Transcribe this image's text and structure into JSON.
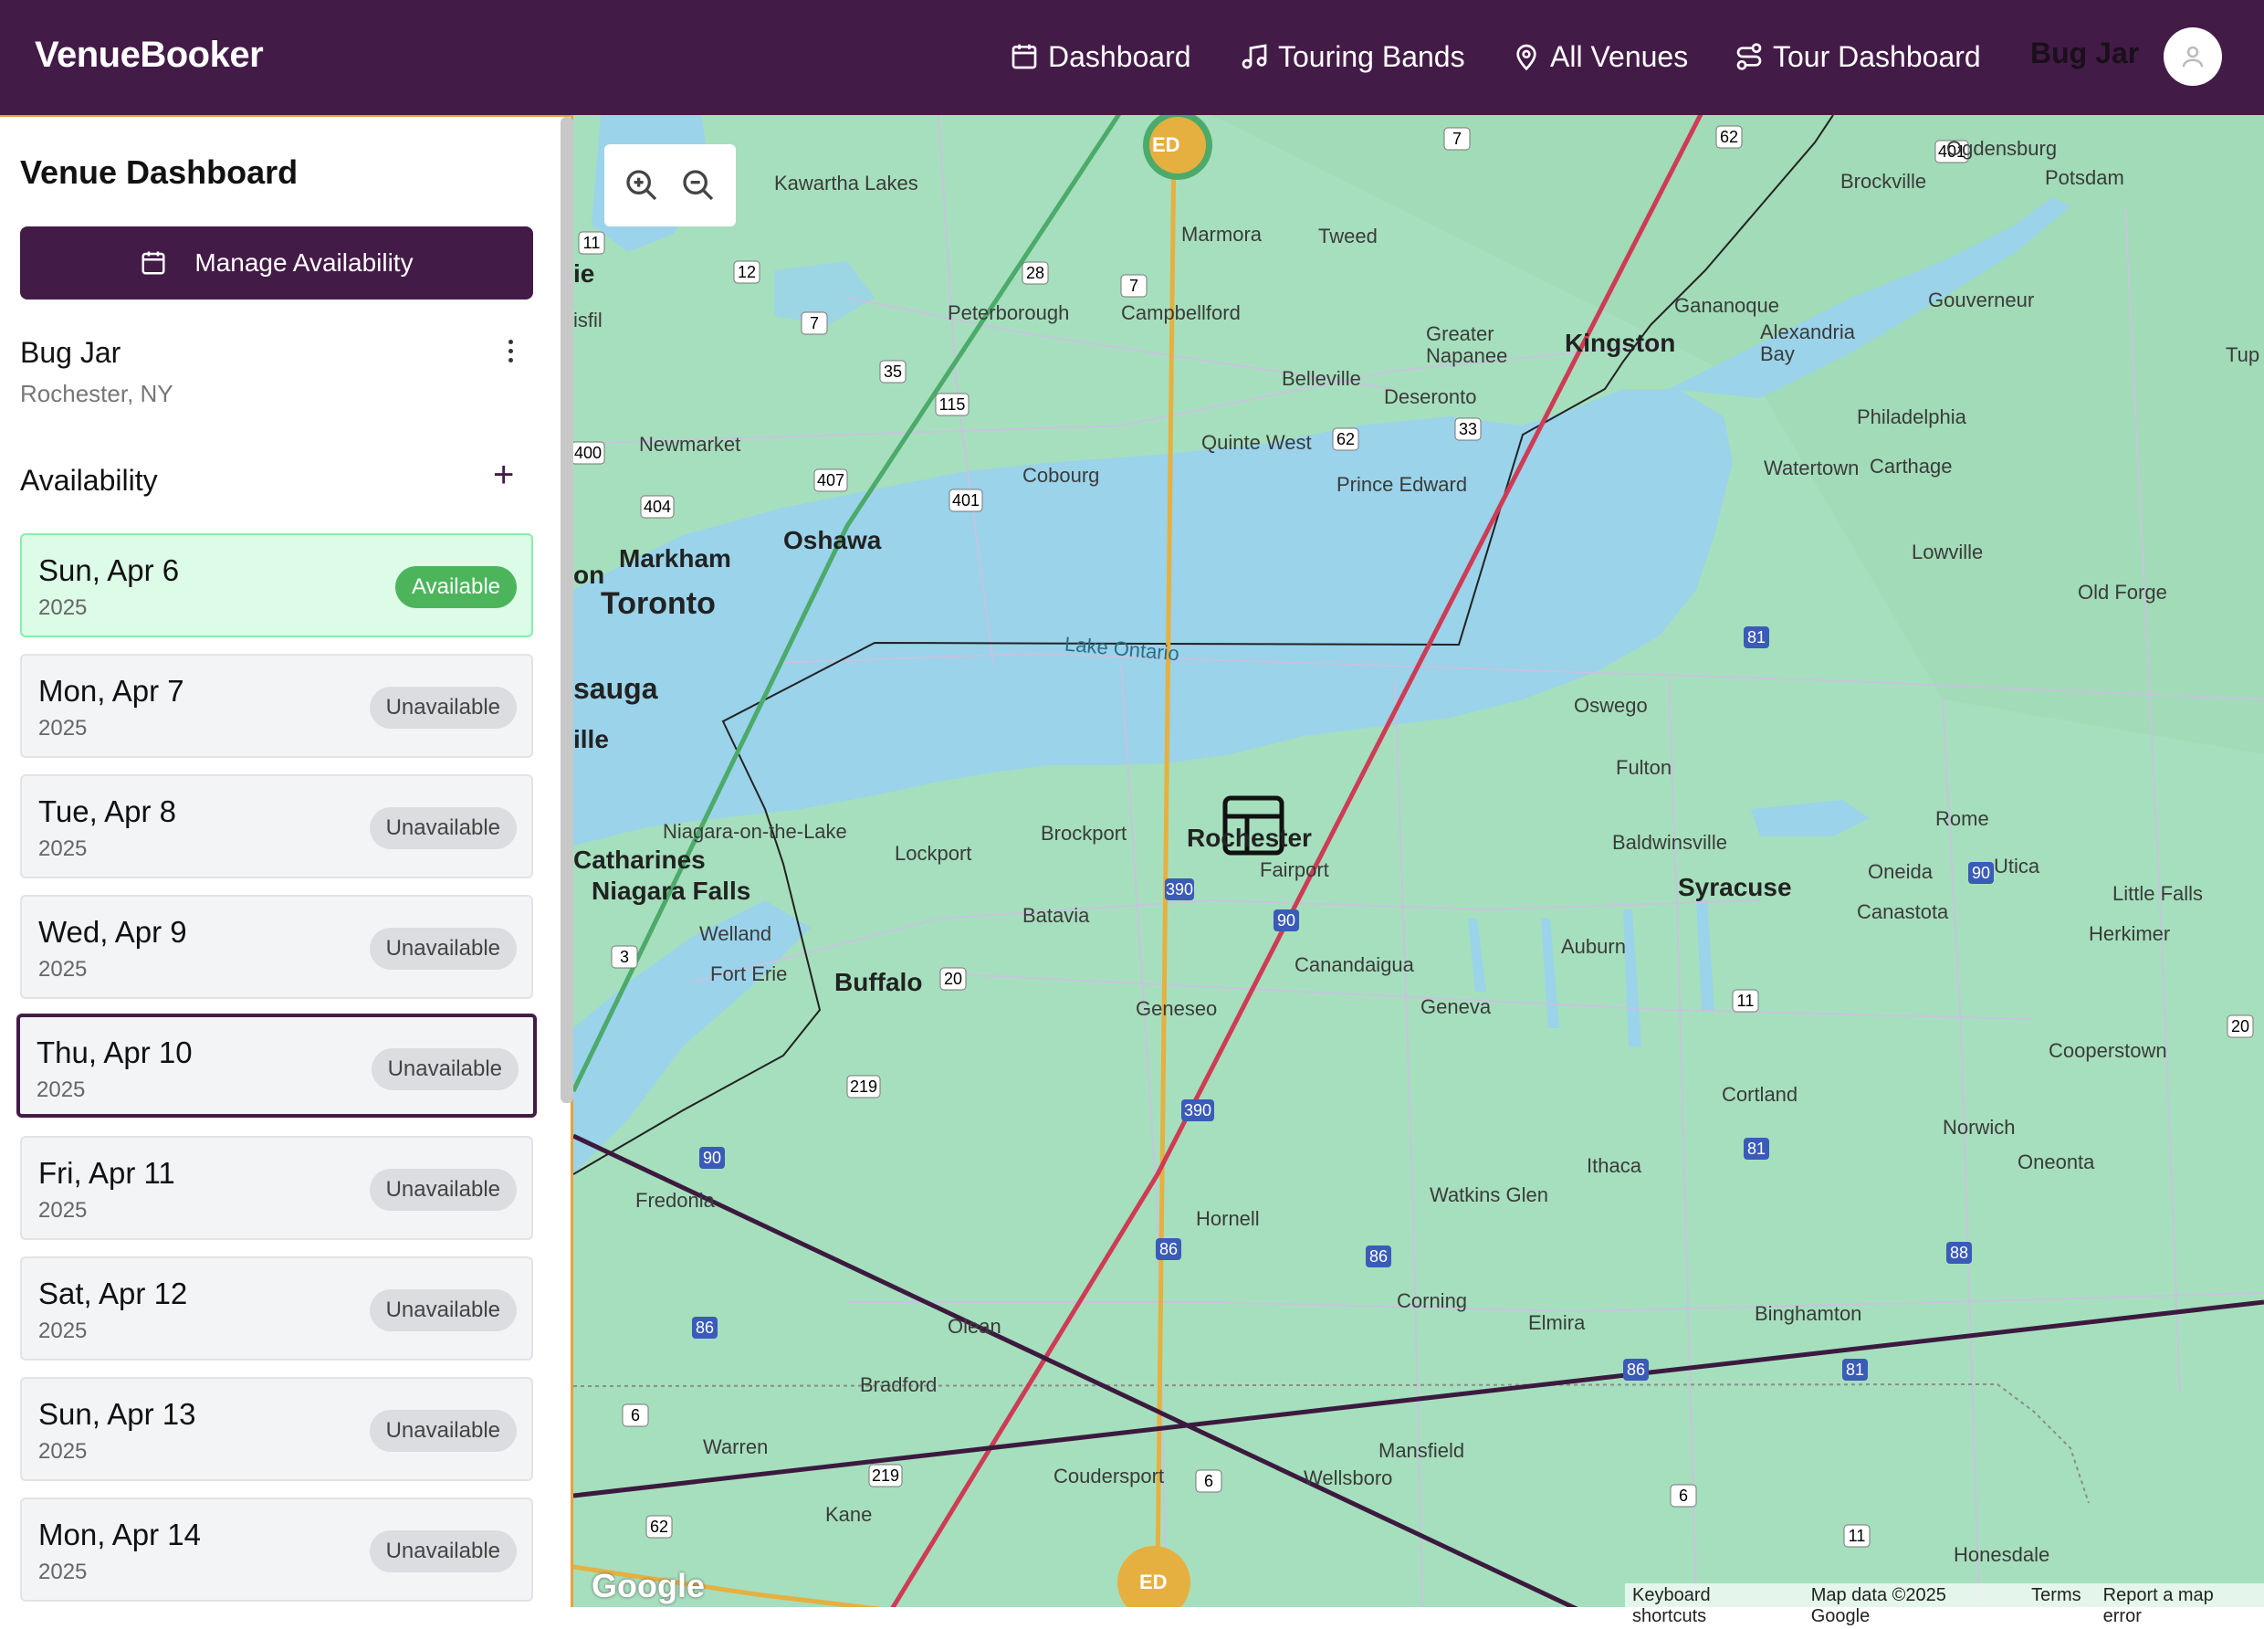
{
  "app": {
    "brand": "VenueBooker"
  },
  "nav": {
    "dashboard": "Dashboard",
    "touring_bands": "Touring Bands",
    "all_venues": "All Venues",
    "tour_dashboard": "Tour Dashboard",
    "user": "Bug Jar"
  },
  "sidebar": {
    "title": "Venue Dashboard",
    "manage_label": "Manage Availability",
    "venue_name": "Bug Jar",
    "venue_location": "Rochester, NY",
    "availability_label": "Availability",
    "days": [
      {
        "date": "Sun, Apr 6",
        "year": "2025",
        "status": "Available"
      },
      {
        "date": "Mon, Apr 7",
        "year": "2025",
        "status": "Unavailable"
      },
      {
        "date": "Tue, Apr 8",
        "year": "2025",
        "status": "Unavailable"
      },
      {
        "date": "Wed, Apr 9",
        "year": "2025",
        "status": "Unavailable"
      },
      {
        "date": "Thu, Apr 10",
        "year": "2025",
        "status": "Unavailable"
      },
      {
        "date": "Fri, Apr 11",
        "year": "2025",
        "status": "Unavailable"
      },
      {
        "date": "Sat, Apr 12",
        "year": "2025",
        "status": "Unavailable"
      },
      {
        "date": "Sun, Apr 13",
        "year": "2025",
        "status": "Unavailable"
      },
      {
        "date": "Mon, Apr 14",
        "year": "2025",
        "status": "Unavailable"
      }
    ]
  },
  "map": {
    "lake_label": "Lake Ontario",
    "marker_label": "ED",
    "places": [
      "Kawartha Lakes",
      "Marmora",
      "Tweed",
      "Peterborough",
      "Campbellford",
      "Greater Napanee",
      "Kingston",
      "Belleville",
      "Deseronto",
      "Quinte West",
      "Prince Edward",
      "Newmarket",
      "Cobourg",
      "Markham",
      "Oshawa",
      "Toronto",
      "Gananoque",
      "Alexandria Bay",
      "Brockville",
      "Ogdensburg",
      "Potsdam",
      "Gouverneur",
      "Philadelphia",
      "Watertown",
      "Carthage",
      "Lowville",
      "Old Forge",
      "Oswego",
      "Fulton",
      "Baldwinsville",
      "Syracuse",
      "Rome",
      "Oneida",
      "Utica",
      "Canastota",
      "Little Falls",
      "Herkimer",
      "Rochester",
      "Fairport",
      "Brockport",
      "Lockport",
      "Niagara-on-the-Lake",
      "Catharines",
      "Niagara Falls",
      "Welland",
      "Batavia",
      "Buffalo",
      "Fort Erie",
      "Canandaigua",
      "Geneseo",
      "Geneva",
      "Auburn",
      "Cortland",
      "Cooperstown",
      "Norwich",
      "Ithaca",
      "Oneonta",
      "Watkins Glen",
      "Hornell",
      "Corning",
      "Elmira",
      "Binghamton",
      "Fredonia",
      "Olean",
      "Bradford",
      "Warren",
      "Coudersport",
      "Mansfield",
      "Wellsboro",
      "Kane",
      "Honesdale",
      "sauga",
      "ille",
      "on",
      "isfil",
      "ie",
      "Tup"
    ],
    "shields": [
      "7",
      "62",
      "401",
      "11",
      "12",
      "28",
      "7",
      "115",
      "35",
      "7",
      "404",
      "407",
      "401",
      "400",
      "62",
      "33",
      "81",
      "90",
      "90",
      "20",
      "3",
      "219",
      "390",
      "11",
      "81",
      "86",
      "86",
      "86",
      "88",
      "81",
      "6",
      "219",
      "6",
      "62",
      "11",
      "6",
      "20",
      "90",
      "90"
    ],
    "footer": {
      "shortcuts": "Keyboard shortcuts",
      "mapdata": "Map data ©2025 Google",
      "terms": "Terms",
      "report": "Report a map error"
    },
    "google": "Google"
  },
  "colors": {
    "brand": "#431b47",
    "accent": "#e6a23c",
    "available": "#4cb55c"
  },
  "icons": [
    "calendar-icon",
    "music-note-icon",
    "map-pin-icon",
    "route-icon",
    "user-icon",
    "zoom-in-icon",
    "zoom-out-icon",
    "more-vertical-icon",
    "plus-icon",
    "layout-panel-icon"
  ]
}
